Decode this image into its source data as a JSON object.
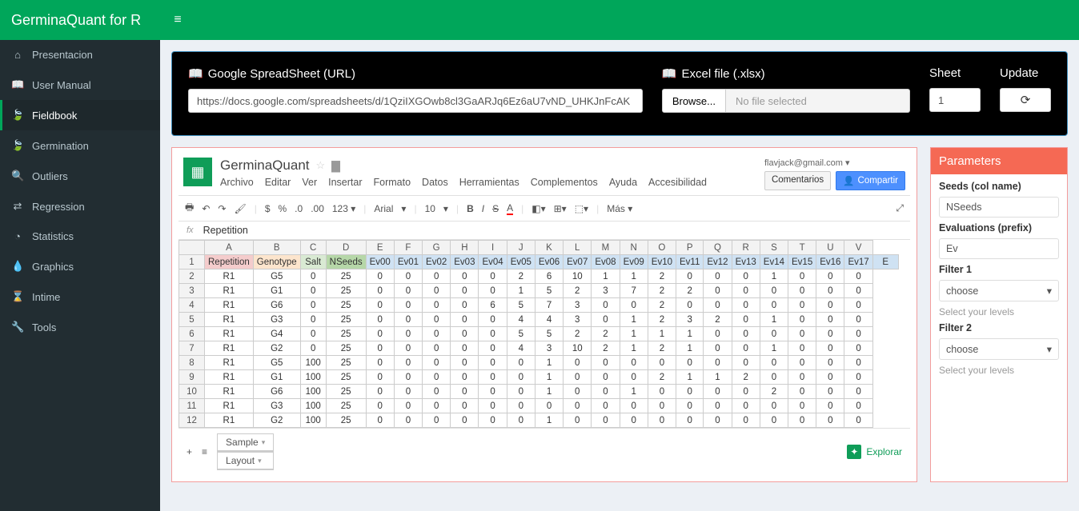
{
  "brand": "GerminaQuant for R",
  "sidebar": {
    "items": [
      {
        "icon": "⌂",
        "label": "Presentacion"
      },
      {
        "icon": "📖",
        "label": "User Manual"
      },
      {
        "icon": "🍃",
        "label": "Fieldbook"
      },
      {
        "icon": "🍃",
        "label": "Germination"
      },
      {
        "icon": "🔍",
        "label": "Outliers"
      },
      {
        "icon": "⇄",
        "label": "Regression"
      },
      {
        "icon": "◔",
        "label": "Statistics"
      },
      {
        "icon": "💧",
        "label": "Graphics"
      },
      {
        "icon": "⌛",
        "label": "Intime"
      },
      {
        "icon": "🔧",
        "label": "Tools"
      }
    ],
    "active": 2
  },
  "blackbox": {
    "url_label": "Google SpreadSheet (URL)",
    "url_value": "https://docs.google.com/spreadsheets/d/1QziIXGOwb8cl3GaARJq6Ez6aU7vND_UHKJnFcAK",
    "excel_label": "Excel file (.xlsx)",
    "browse_label": "Browse...",
    "nofile_label": "No file selected",
    "sheet_label": "Sheet",
    "sheet_value": "1",
    "update_label": "Update"
  },
  "sheet": {
    "title": "GerminaQuant",
    "email": "flavjack@gmail.com ▾",
    "menus": [
      "Archivo",
      "Editar",
      "Ver",
      "Insertar",
      "Formato",
      "Datos",
      "Herramientas",
      "Complementos",
      "Ayuda",
      "Accesibilidad"
    ],
    "comments": "Comentarios",
    "share": "Compartir",
    "toolbar": {
      "font": "Arial",
      "size": "10",
      "more": "Más ▾",
      "num": "123 ▾"
    },
    "fx": "Repetition",
    "cols_letters": [
      "",
      "A",
      "B",
      "C",
      "D",
      "E",
      "F",
      "G",
      "H",
      "I",
      "J",
      "K",
      "L",
      "M",
      "N",
      "O",
      "P",
      "Q",
      "R",
      "S",
      "T",
      "U",
      "V"
    ],
    "headers": [
      "Repetition",
      "Genotype",
      "Salt",
      "NSeeds",
      "Ev00",
      "Ev01",
      "Ev02",
      "Ev03",
      "Ev04",
      "Ev05",
      "Ev06",
      "Ev07",
      "Ev08",
      "Ev09",
      "Ev10",
      "Ev11",
      "Ev12",
      "Ev13",
      "Ev14",
      "Ev15",
      "Ev16",
      "Ev17",
      "E"
    ],
    "rows": [
      [
        "R1",
        "G5",
        "0",
        "25",
        "0",
        "0",
        "0",
        "0",
        "0",
        "2",
        "6",
        "10",
        "1",
        "1",
        "2",
        "0",
        "0",
        "0",
        "1",
        "0",
        "0",
        "0"
      ],
      [
        "R1",
        "G1",
        "0",
        "25",
        "0",
        "0",
        "0",
        "0",
        "0",
        "1",
        "5",
        "2",
        "3",
        "7",
        "2",
        "2",
        "0",
        "0",
        "0",
        "0",
        "0",
        "0"
      ],
      [
        "R1",
        "G6",
        "0",
        "25",
        "0",
        "0",
        "0",
        "0",
        "6",
        "5",
        "7",
        "3",
        "0",
        "0",
        "2",
        "0",
        "0",
        "0",
        "0",
        "0",
        "0",
        "0"
      ],
      [
        "R1",
        "G3",
        "0",
        "25",
        "0",
        "0",
        "0",
        "0",
        "0",
        "4",
        "4",
        "3",
        "0",
        "1",
        "2",
        "3",
        "2",
        "0",
        "1",
        "0",
        "0",
        "0"
      ],
      [
        "R1",
        "G4",
        "0",
        "25",
        "0",
        "0",
        "0",
        "0",
        "0",
        "5",
        "5",
        "2",
        "2",
        "1",
        "1",
        "1",
        "0",
        "0",
        "0",
        "0",
        "0",
        "0"
      ],
      [
        "R1",
        "G2",
        "0",
        "25",
        "0",
        "0",
        "0",
        "0",
        "0",
        "4",
        "3",
        "10",
        "2",
        "1",
        "2",
        "1",
        "0",
        "0",
        "1",
        "0",
        "0",
        "0"
      ],
      [
        "R1",
        "G5",
        "100",
        "25",
        "0",
        "0",
        "0",
        "0",
        "0",
        "0",
        "1",
        "0",
        "0",
        "0",
        "0",
        "0",
        "0",
        "0",
        "0",
        "0",
        "0",
        "0"
      ],
      [
        "R1",
        "G1",
        "100",
        "25",
        "0",
        "0",
        "0",
        "0",
        "0",
        "0",
        "1",
        "0",
        "0",
        "0",
        "2",
        "1",
        "1",
        "2",
        "0",
        "0",
        "0",
        "0"
      ],
      [
        "R1",
        "G6",
        "100",
        "25",
        "0",
        "0",
        "0",
        "0",
        "0",
        "0",
        "1",
        "0",
        "0",
        "1",
        "0",
        "0",
        "0",
        "0",
        "2",
        "0",
        "0",
        "0"
      ],
      [
        "R1",
        "G3",
        "100",
        "25",
        "0",
        "0",
        "0",
        "0",
        "0",
        "0",
        "0",
        "0",
        "0",
        "0",
        "0",
        "0",
        "0",
        "0",
        "0",
        "0",
        "0",
        "0"
      ],
      [
        "R1",
        "G2",
        "100",
        "25",
        "0",
        "0",
        "0",
        "0",
        "0",
        "0",
        "1",
        "0",
        "0",
        "0",
        "0",
        "0",
        "0",
        "0",
        "0",
        "0",
        "0",
        "0"
      ]
    ],
    "tabs": [
      "Sample",
      "Layout"
    ],
    "explore": "Explorar"
  },
  "params": {
    "title": "Parameters",
    "seeds_label": "Seeds (col name)",
    "seeds_value": "NSeeds",
    "eval_label": "Evaluations (prefix)",
    "eval_value": "Ev",
    "f1_label": "Filter 1",
    "choose": "choose",
    "levels": "Select your levels",
    "f2_label": "Filter 2"
  }
}
